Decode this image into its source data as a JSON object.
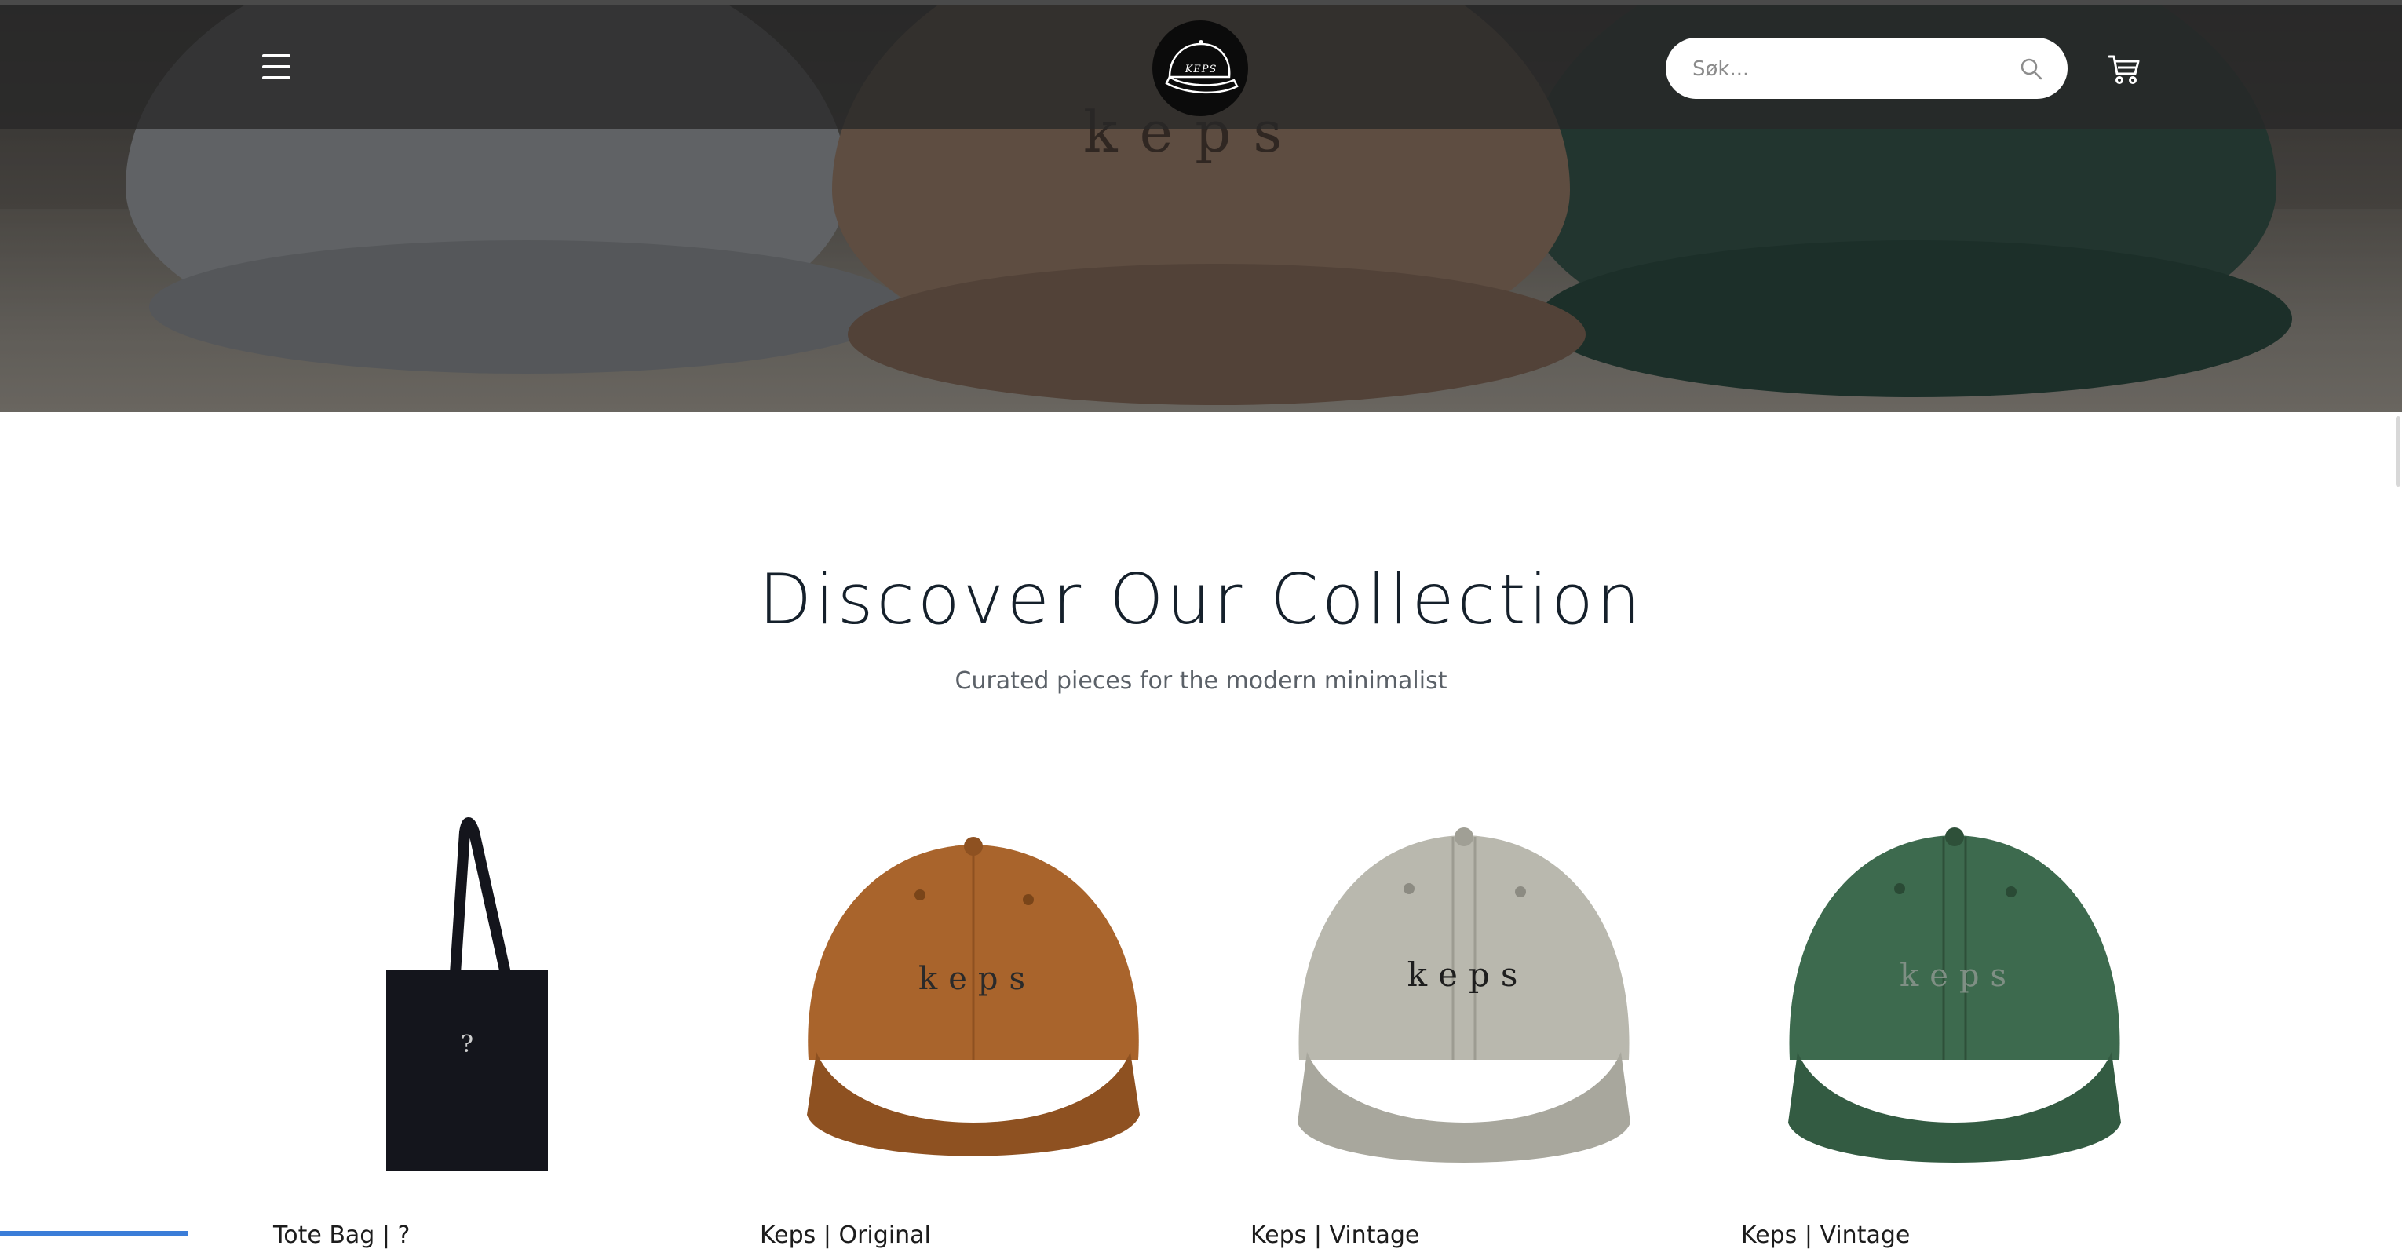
{
  "header": {
    "logo_text": "KEPS",
    "search": {
      "placeholder": "Søk..."
    },
    "icons": {
      "menu": "hamburger-icon",
      "search": "search-icon",
      "cart": "cart-icon"
    }
  },
  "hero": {
    "brand_word": "keps"
  },
  "collection": {
    "title": "Discover Our Collection",
    "subtitle": "Curated pieces for the modern minimalist",
    "products": [
      {
        "name": "Tote Bag | ?",
        "image": "tote-bag",
        "color": "#14151c"
      },
      {
        "name": "Keps | Original",
        "image": "corduroy-cap",
        "color": "#a9642c"
      },
      {
        "name": "Keps | Vintage",
        "image": "stone-cap",
        "color": "#b9b8ae"
      },
      {
        "name": "Keps | Vintage",
        "image": "green-cap",
        "color": "#3d6a4e"
      }
    ]
  },
  "colors": {
    "header_bg": "#282828",
    "heading": "#15202b",
    "subheading": "#5b6168",
    "logo_bg": "#0b0b0b"
  }
}
